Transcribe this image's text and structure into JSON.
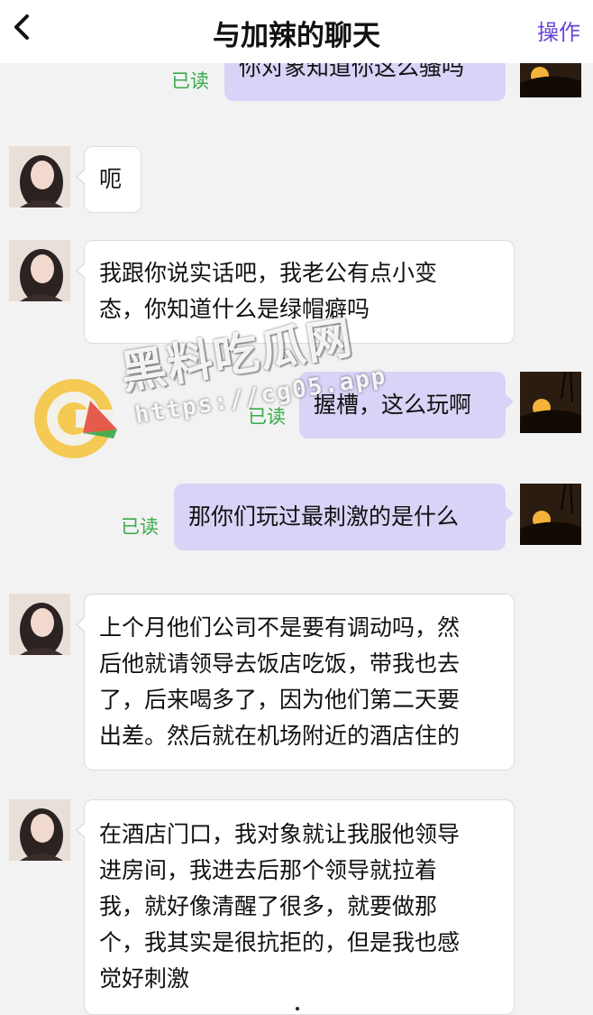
{
  "header": {
    "back_icon": "chevron-left-icon",
    "title": "与加辣的聊天",
    "action_label": "操作"
  },
  "colors": {
    "accent": "#6a43d6",
    "self_bubble": "#d9d3f7",
    "other_bubble": "#ffffff",
    "read_status": "#3aab4a"
  },
  "messages": [
    {
      "side": "right",
      "text": "你对象知道你这么骚吗",
      "status": "已读"
    },
    {
      "side": "left",
      "text": "呃"
    },
    {
      "side": "left",
      "lines": [
        "我跟你说实话吧，我老公有点小变",
        "态，你知道什么是绿帽癖吗"
      ]
    },
    {
      "side": "right",
      "text": "握槽，这么玩啊",
      "status": "已读"
    },
    {
      "side": "right",
      "text": "那你们玩过最刺激的是什么",
      "status": "已读"
    },
    {
      "side": "left",
      "lines": [
        "上个月他们公司不是要有调动吗，然",
        "后他就请领导去饭店吃饭，带我也去",
        "了，后来喝多了，因为他们第二天要",
        "出差。然后就在机场附近的酒店住的"
      ]
    },
    {
      "side": "left",
      "lines": [
        "在酒店门口，我对象就让我服他领导",
        "进房间，我进去后那个领导就拉着",
        "我，就好像清醒了很多，就要做那",
        "个，我其实是很抗拒的，但是我也感",
        "觉好刺激"
      ]
    }
  ],
  "watermark": {
    "title": "黑料吃瓜网",
    "url": "https://cg05.app"
  }
}
